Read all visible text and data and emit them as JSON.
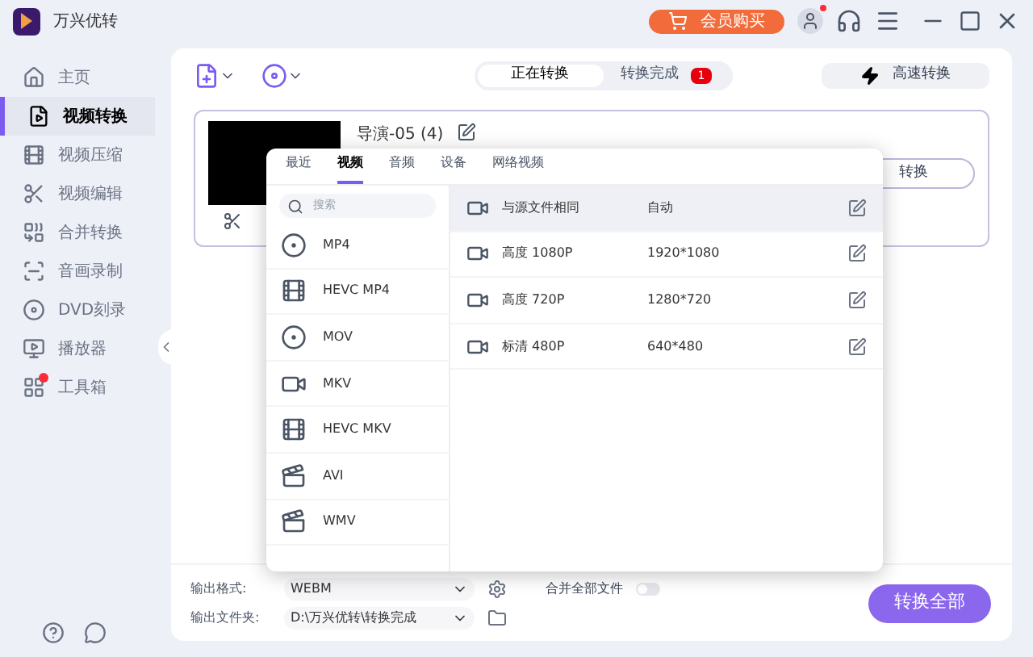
{
  "window": {
    "title": "万兴优转"
  },
  "title_bar": {
    "buy_button": "会员购买",
    "user_notification": true
  },
  "sidebar": {
    "items": [
      {
        "label": "主页",
        "selected": false,
        "badge_dot": false
      },
      {
        "label": "视频转换",
        "selected": true,
        "badge_dot": false
      },
      {
        "label": "视频压缩",
        "selected": false,
        "badge_dot": false
      },
      {
        "label": "视频编辑",
        "selected": false,
        "badge_dot": false
      },
      {
        "label": "合并转换",
        "selected": false,
        "badge_dot": false
      },
      {
        "label": "音画录制",
        "selected": false,
        "badge_dot": false
      },
      {
        "label": "DVD刻录",
        "selected": false,
        "badge_dot": false
      },
      {
        "label": "播放器",
        "selected": false,
        "badge_dot": false
      },
      {
        "label": "工具箱",
        "selected": false,
        "badge_dot": true
      }
    ]
  },
  "toolbar": {
    "tabs": [
      {
        "label": "正在转换",
        "selected": true
      },
      {
        "label": "转换完成",
        "selected": false,
        "badge": "1"
      }
    ],
    "fast_convert": "高速转换"
  },
  "file": {
    "title": "导演-05 (4)",
    "convert_button": "转换"
  },
  "format_popup": {
    "tabs": [
      {
        "label": "最近",
        "selected": false
      },
      {
        "label": "视频",
        "selected": true
      },
      {
        "label": "音频",
        "selected": false
      },
      {
        "label": "设备",
        "selected": false
      },
      {
        "label": "网络视频",
        "selected": false
      }
    ],
    "search": {
      "placeholder": "搜索"
    },
    "formats": [
      {
        "label": "MP4",
        "kind": "disc"
      },
      {
        "label": "HEVC MP4",
        "kind": "hevc"
      },
      {
        "label": "MOV",
        "kind": "disc"
      },
      {
        "label": "MKV",
        "kind": "video"
      },
      {
        "label": "HEVC MKV",
        "kind": "hevc"
      },
      {
        "label": "AVI",
        "kind": "clapper"
      },
      {
        "label": "WMV",
        "kind": "clapper"
      }
    ],
    "presets": [
      {
        "name": "与源文件相同",
        "resolution": "自动",
        "selected": true
      },
      {
        "name": "高度 1080P",
        "resolution": "1920*1080",
        "selected": false
      },
      {
        "name": "高度 720P",
        "resolution": "1280*720",
        "selected": false
      },
      {
        "name": "标清 480P",
        "resolution": "640*480",
        "selected": false
      }
    ]
  },
  "bottom": {
    "output_format_label": "输出格式:",
    "output_format": "WEBM",
    "merge_label": "合并全部文件",
    "merge_on": false,
    "output_folder_label": "输出文件夹:",
    "output_folder": "D:\\万兴优转\\转换完成",
    "convert_all": "转换全部"
  }
}
